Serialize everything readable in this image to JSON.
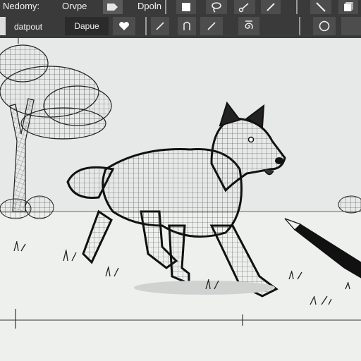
{
  "toolbar": {
    "menu_left": "Nedomy:",
    "menu_mid": "Orvpe",
    "menu_right": "Dpoln",
    "dropdown_label": "datpout",
    "active_button_label": "Dapue"
  },
  "icons": [
    "square-icon",
    "lasso-icon",
    "pen-node-icon",
    "pencil-icon",
    "slash-icon",
    "cube-icon",
    "tag-icon",
    "heart-icon",
    "pencil-icon",
    "shape-icon",
    "pencil-icon",
    "spiral-icon",
    "circle-icon"
  ],
  "colors": {
    "toolbar_bg": "#3a3a3a",
    "canvas_bg": "#e6e9e7",
    "ink": "#111111"
  }
}
